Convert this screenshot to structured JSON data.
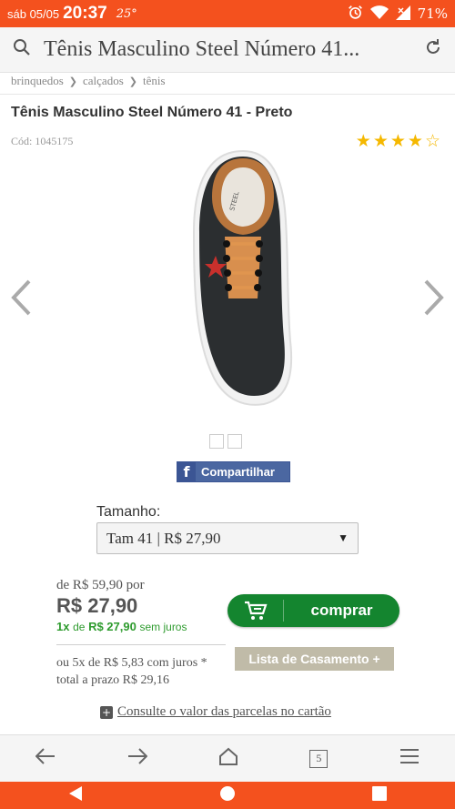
{
  "status_bar": {
    "date": "sáb 05/05",
    "time": "20:37",
    "temperature": "25°",
    "battery": "71%",
    "icons": [
      "alarm-icon",
      "wifi-icon",
      "signal-icon"
    ]
  },
  "url_bar": {
    "page_title": "Tênis Masculino Steel Número 41..."
  },
  "breadcrumb": [
    "brinquedos",
    "calçados",
    "tênis"
  ],
  "product": {
    "title": "Tênis Masculino Steel Número 41 - Preto",
    "code": "Cód: 1045175",
    "rating": 4.5,
    "image_count": 2
  },
  "share": {
    "label": "Compartilhar"
  },
  "size": {
    "label": "Tamanho:",
    "selected": "Tam 41 | R$ 27,90"
  },
  "pricing": {
    "old_price": "de R$ 59,90 por",
    "current_price": "R$ 27,90",
    "installment_prefix": "1x",
    "installment_de": "de",
    "installment_value": "R$ 27,90",
    "installment_suffix": "sem juros",
    "installments_line1": "ou 5x de R$ 5,83 com juros *",
    "installments_line2": "total a prazo R$ 29,16"
  },
  "actions": {
    "buy_label": "comprar",
    "registry_label": "Lista de Casamento +"
  },
  "consult": {
    "label": "Consulte o valor das parcelas no cartão"
  },
  "browser": {
    "tab_count": "5"
  },
  "colors": {
    "accent": "#f4511e",
    "buy_green": "#14852f",
    "installment_green": "#2e9b2e",
    "star": "#f5b800",
    "facebook": "#4b67a1"
  }
}
